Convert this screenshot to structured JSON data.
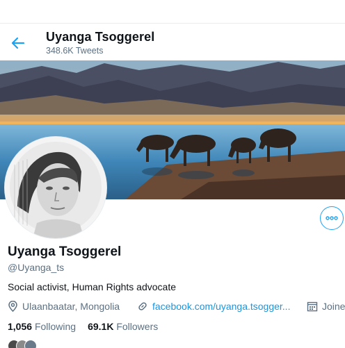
{
  "header": {
    "name": "Uyanga Tsoggerel",
    "tweet_count": "348.6K Tweets"
  },
  "profile": {
    "name": "Uyanga Tsoggerel",
    "handle": "@Uyanga_ts",
    "bio": "Social activist, Human Rights advocate",
    "location": "Ulaanbaatar, Mongolia",
    "website": "facebook.com/uyanga.tsogger...",
    "joined": "Joined"
  },
  "stats": {
    "following_count": "1,056",
    "following_label": "Following",
    "followers_count": "69.1K",
    "followers_label": "Followers"
  },
  "icons": {
    "back": "arrow-left-icon",
    "more": "more-dots-icon",
    "location": "location-pin-icon",
    "link": "link-icon",
    "calendar": "calendar-icon"
  },
  "colors": {
    "accent": "#1da1f2",
    "link": "#1b95e0",
    "secondary_text": "#5b7083",
    "primary_text": "#0f1419"
  }
}
